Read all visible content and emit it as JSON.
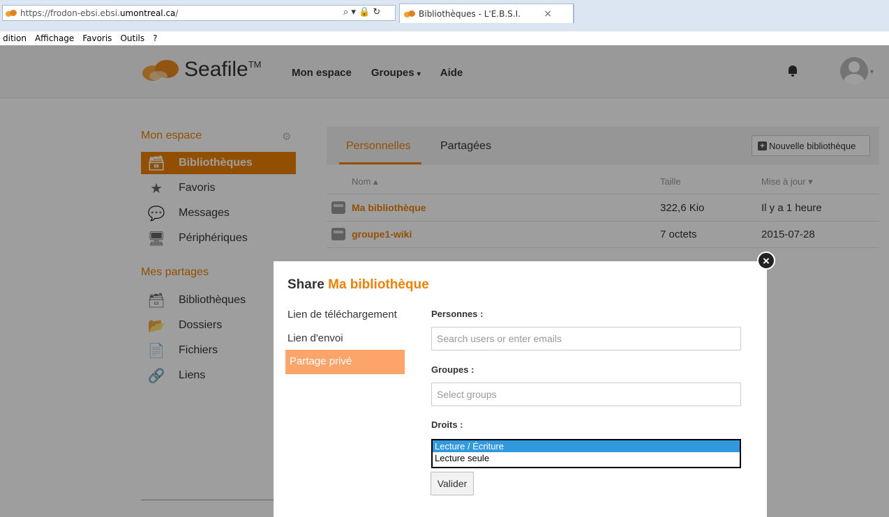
{
  "browser": {
    "url_proto": "https://frodon-ebsi.ebsi.",
    "url_host": "umontreal.ca",
    "url_path": "/",
    "controls": "⌕ ▾ 🔒 ↻",
    "tab_title": "Bibliothèques - L'E.B.S.I.",
    "tab_close": "×",
    "menu": [
      "dition",
      "Affichage",
      "Favoris",
      "Outils",
      "?"
    ]
  },
  "header": {
    "logo_text": "Seafile",
    "logo_tm": "TM",
    "nav": [
      {
        "label": "Mon espace"
      },
      {
        "label": "Groupes",
        "caret": "▾"
      },
      {
        "label": "Aide"
      }
    ]
  },
  "sidebar": {
    "section1_title": "Mon espace",
    "items1": [
      {
        "label": "Bibliothèques",
        "icon": "🗃",
        "active": true
      },
      {
        "label": "Favoris",
        "icon": "★"
      },
      {
        "label": "Messages",
        "icon": "💬"
      },
      {
        "label": "Périphériques",
        "icon": "🖥"
      }
    ],
    "section2_title": "Mes partages",
    "items2": [
      {
        "label": "Bibliothèques",
        "icon": "🗃"
      },
      {
        "label": "Dossiers",
        "icon": "📂"
      },
      {
        "label": "Fichiers",
        "icon": "📄"
      },
      {
        "label": "Liens",
        "icon": "🔗"
      }
    ]
  },
  "main": {
    "tabs": [
      "Personnelles",
      "Partagées"
    ],
    "new_library": "Nouvelle bibliothèque",
    "columns": {
      "name": "Nom ▴",
      "size": "Taille",
      "updated": "Mise à jour ▾"
    },
    "rows": [
      {
        "name": "Ma bibliothèque",
        "size": "322,6 Kio",
        "updated": "Il y a 1 heure"
      },
      {
        "name": "groupe1-wiki",
        "size": "7 octets",
        "updated": "2015-07-28"
      }
    ]
  },
  "modal": {
    "title_prefix": "Share",
    "title_lib": "Ma bibliothèque",
    "close": "×",
    "nav": [
      "Lien de téléchargement",
      "Lien d'envoi",
      "Partage privé"
    ],
    "persons_label": "Personnes :",
    "persons_placeholder": "Search users or enter emails",
    "groups_label": "Groupes :",
    "groups_placeholder": "Select groups",
    "rights_label": "Droits :",
    "rights_options": [
      "Lecture / Écriture",
      "Lecture seule"
    ],
    "submit": "Valider"
  },
  "colors": {
    "accent": "#eb8205",
    "active_nav": "#fda46b",
    "select_highlight": "#3399dd"
  }
}
